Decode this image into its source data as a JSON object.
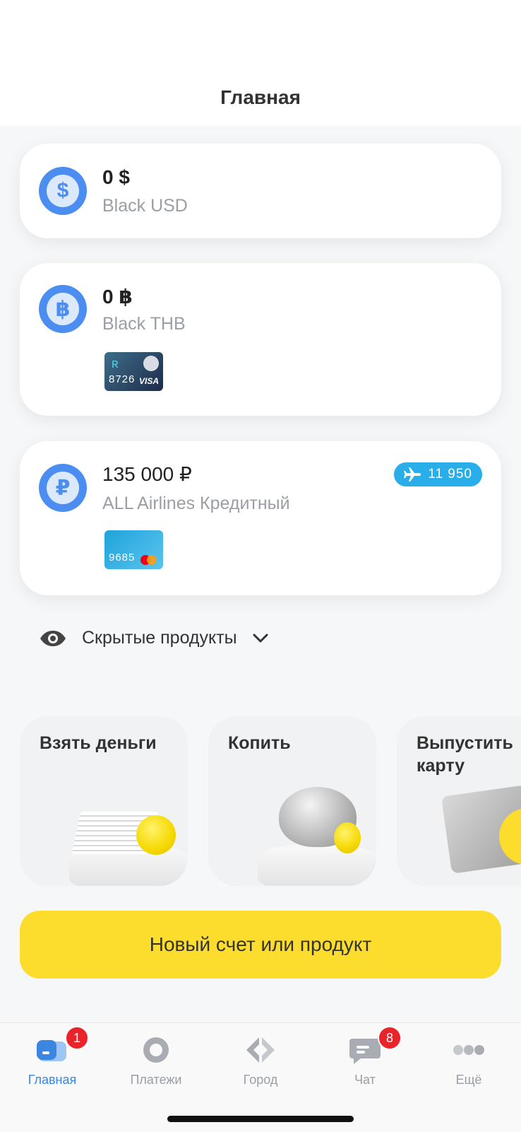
{
  "header": {
    "title": "Главная"
  },
  "accounts": [
    {
      "amount": "0 $",
      "name": "Black USD",
      "currency_icon": "dollar-icon",
      "symbol": "$"
    },
    {
      "amount": "0 ฿",
      "name": "Black THB",
      "currency_icon": "baht-icon",
      "symbol": "฿",
      "card_number": "8726",
      "card_network": "VISA"
    },
    {
      "amount": "135 000 ₽",
      "name": "ALL Airlines Кредитный",
      "currency_icon": "ruble-icon",
      "symbol": "₽",
      "card_number": "9685",
      "card_network": "mastercard",
      "miles": "11 950"
    }
  ],
  "hidden_products": {
    "label": "Скрытые продукты"
  },
  "offers": [
    {
      "title": "Взять деньги"
    },
    {
      "title": "Копить"
    },
    {
      "title": "Выпустить карту"
    }
  ],
  "cta": {
    "label": "Новый счет или продукт"
  },
  "tabbar": {
    "items": [
      {
        "label": "Главная",
        "badge": "1"
      },
      {
        "label": "Платежи"
      },
      {
        "label": "Город"
      },
      {
        "label": "Чат",
        "badge": "8"
      },
      {
        "label": "Ещё"
      }
    ]
  },
  "colors": {
    "accent_blue": "#4b8df0",
    "cta_yellow": "#fcdc2c",
    "miles_blue": "#29aeea",
    "badge_red": "#e8242a"
  }
}
